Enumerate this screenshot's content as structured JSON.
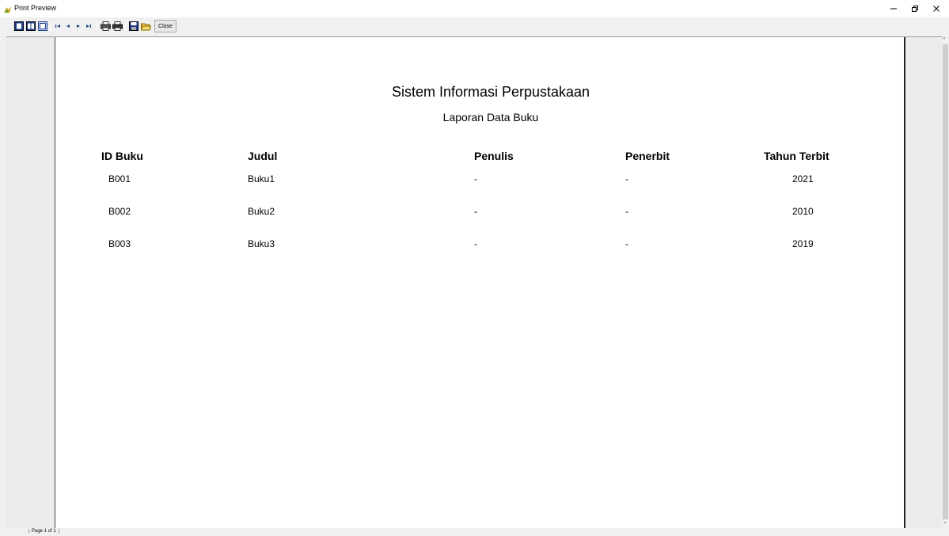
{
  "window": {
    "title": "Print Preview"
  },
  "toolbar": {
    "close_label": "Close",
    "buttons": [
      "one-page-icon",
      "two-page-icon",
      "whole-page-icon",
      "first-page-icon",
      "previous-page-icon",
      "next-page-icon",
      "last-page-icon",
      "print-setup-icon",
      "print-icon",
      "save-icon",
      "open-icon"
    ]
  },
  "report": {
    "title": "Sistem Informasi Perpustakaan",
    "subtitle": "Laporan Data Buku",
    "columns": [
      "ID Buku",
      "Judul",
      "Penulis",
      "Penerbit",
      "Tahun Terbit"
    ],
    "rows": [
      [
        "B001",
        "Buku1",
        "-",
        "-",
        "2021"
      ],
      [
        "B002",
        "Buku2",
        "-",
        "-",
        "2010"
      ],
      [
        "B003",
        "Buku3",
        "-",
        "-",
        "2019"
      ]
    ]
  },
  "status": {
    "page": "Page 1 of 1"
  },
  "colors": {
    "title_bar": "#ffffff",
    "chrome": "#f0f0f0",
    "page": "#ffffff"
  }
}
